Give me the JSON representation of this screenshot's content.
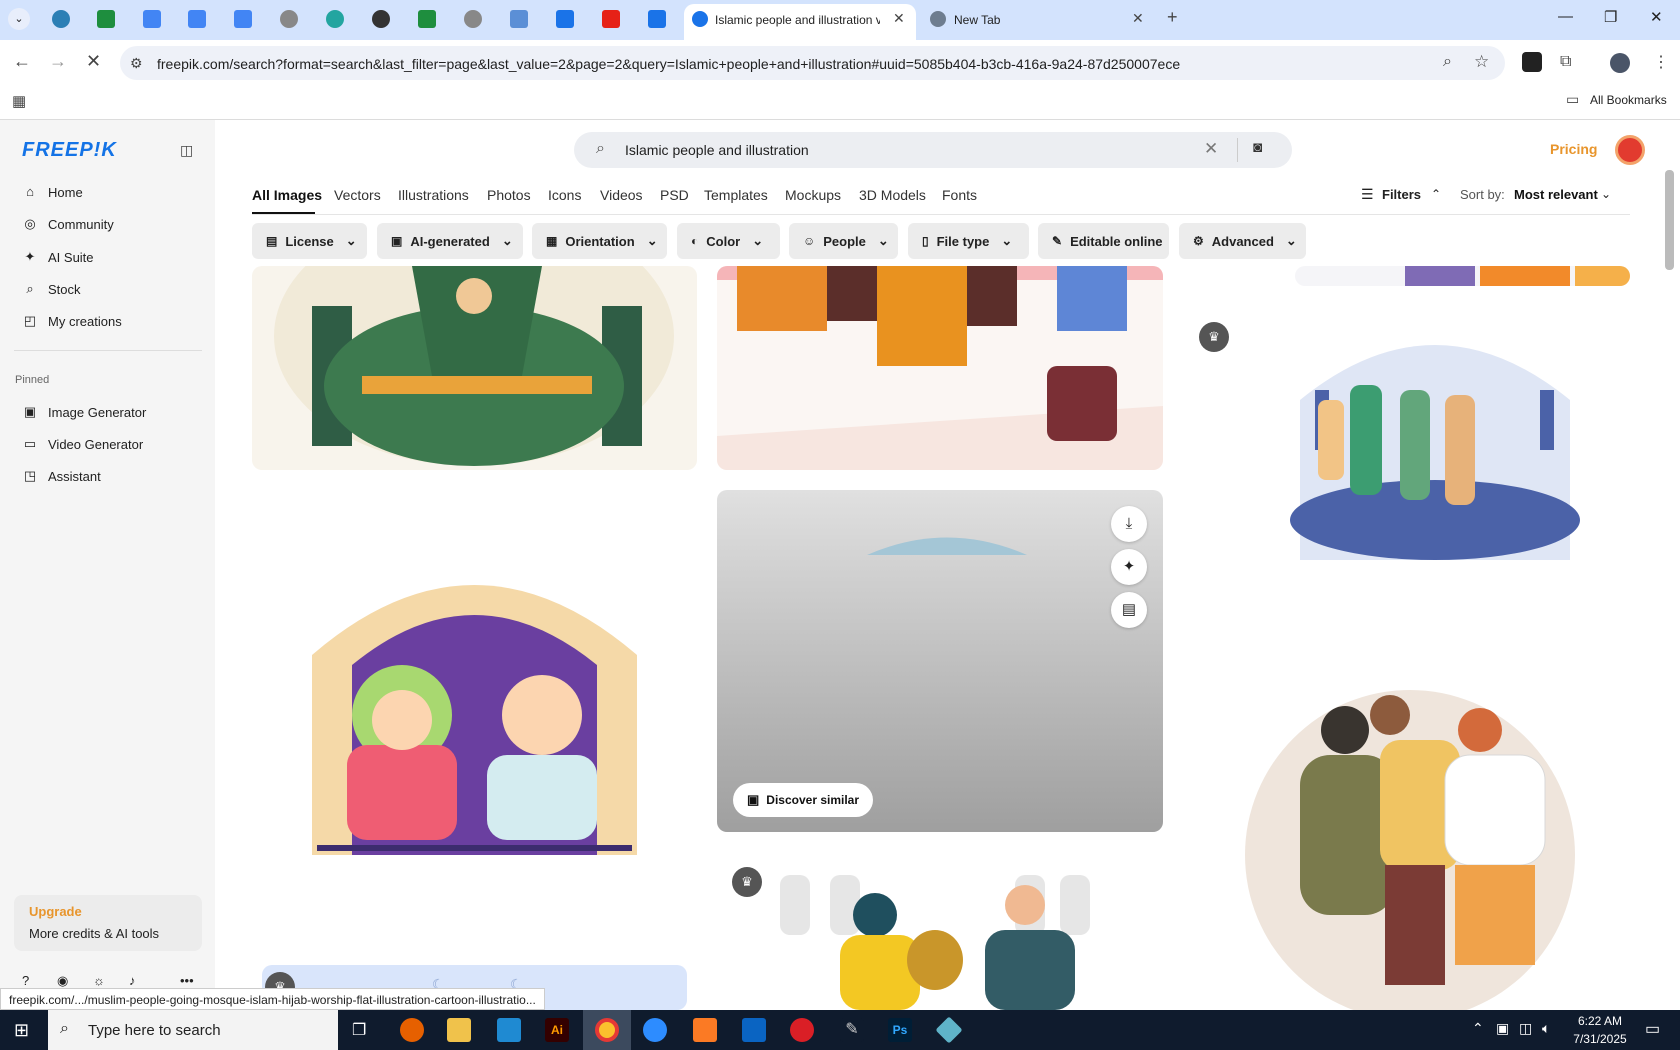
{
  "browser": {
    "active_tab_title": "Islamic people and illustration v",
    "new_tab_title": "New Tab",
    "url": "freepik.com/search?format=search&last_filter=page&last_value=2&page=2&query=Islamic+people+and+illustration#uuid=5085b404-b3cb-416a-9a24-87d250007ece",
    "all_bookmarks": "All Bookmarks"
  },
  "sidebar": {
    "logo": "FREEP!K",
    "items": [
      {
        "label": "Home",
        "icon": "home-icon"
      },
      {
        "label": "Community",
        "icon": "globe-icon"
      },
      {
        "label": "AI Suite",
        "icon": "sparkle-icon"
      },
      {
        "label": "Stock",
        "icon": "search-icon"
      },
      {
        "label": "My creations",
        "icon": "creations-icon"
      }
    ],
    "pinned_label": "Pinned",
    "pinned_items": [
      {
        "label": "Image Generator",
        "icon": "image-icon"
      },
      {
        "label": "Video Generator",
        "icon": "video-icon"
      },
      {
        "label": "Assistant",
        "icon": "assistant-icon"
      }
    ],
    "upgrade_title": "Upgrade",
    "upgrade_sub": "More credits & AI tools"
  },
  "header": {
    "search_value": "Islamic people and illustration",
    "pricing": "Pricing"
  },
  "categories": [
    "All Images",
    "Vectors",
    "Illustrations",
    "Photos",
    "Icons",
    "Videos",
    "PSD",
    "Templates",
    "Mockups",
    "3D Models",
    "Fonts"
  ],
  "filters_label": "Filters",
  "sort_label": "Sort by:",
  "sort_value": "Most relevant",
  "chips": [
    "License",
    "AI-generated",
    "Orientation",
    "Color",
    "People",
    "File type",
    "Editable online",
    "Advanced"
  ],
  "discover_similar": "Discover similar",
  "status_url": "freepik.com/.../muslim-people-going-mosque-islam-hijab-worship-flat-illustration-cartoon-illustratio...",
  "taskbar": {
    "search_placeholder": "Type here to search",
    "time": "6:22 AM",
    "date": "7/31/2025"
  }
}
